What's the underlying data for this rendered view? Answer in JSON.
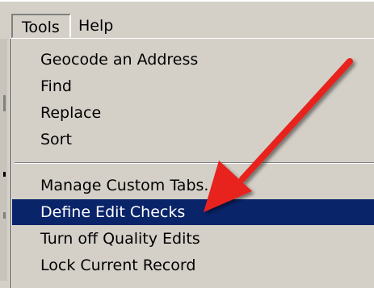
{
  "menubar": {
    "items": [
      {
        "label": "Tools",
        "active": true
      },
      {
        "label": "Help",
        "active": false
      }
    ]
  },
  "tools_menu": {
    "groups": [
      {
        "items": [
          {
            "label": "Geocode an Address",
            "highlighted": false
          },
          {
            "label": "Find",
            "highlighted": false
          },
          {
            "label": "Replace",
            "highlighted": false
          },
          {
            "label": "Sort",
            "highlighted": false
          }
        ]
      },
      {
        "items": [
          {
            "label": "Manage Custom Tabs.",
            "highlighted": false
          },
          {
            "label": "Define Edit Checks",
            "highlighted": true
          },
          {
            "label": "Turn off Quality Edits",
            "highlighted": false
          },
          {
            "label": "Lock Current Record",
            "highlighted": false
          }
        ]
      }
    ]
  },
  "annotation": {
    "icon": "red-arrow-icon",
    "color": "#e8201c",
    "points_to": "Define Edit Checks"
  },
  "colors": {
    "menu_background": "#d4d0c8",
    "highlight_background": "#0a246a",
    "highlight_text": "#ffffff"
  }
}
